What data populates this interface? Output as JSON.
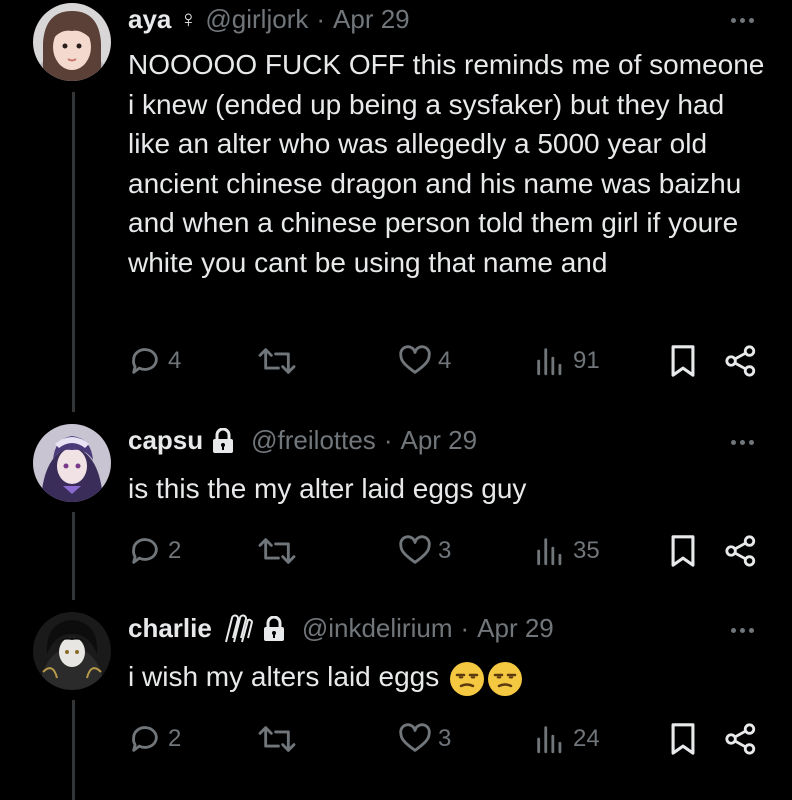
{
  "tweets": [
    {
      "name": "aya",
      "name_badge": "♀",
      "handle": "@girljork",
      "separator": "·",
      "date": "Apr 29",
      "text": "NOOOOO FUCK OFF this reminds me of someone i knew (ended up being a sysfaker) but they had like an alter who was allegedly a 5000 year old ancient chinese dragon and his name was baizhu and when a chinese person told them girl if youre white you cant be using that name and",
      "replies": "4",
      "retweets": "",
      "likes": "4",
      "views": "91",
      "protected": false
    },
    {
      "name": "capsu",
      "handle": "@freilottes",
      "separator": "·",
      "date": "Apr 29",
      "text": "is this the my alter laid eggs guy",
      "replies": "2",
      "retweets": "",
      "likes": "3",
      "views": "35",
      "protected": true
    },
    {
      "name": "charlie",
      "handle": "@inkdelirium",
      "separator": "·",
      "date": "Apr 29",
      "text": "i wish my alters laid eggs",
      "replies": "2",
      "retweets": "",
      "likes": "3",
      "views": "24",
      "protected": true,
      "emoji": [
        "unamused-face",
        "unamused-face"
      ]
    }
  ],
  "colors": {
    "background": "#000000",
    "text": "#e7e9ea",
    "muted": "#71767b",
    "thread_line": "#333639"
  }
}
